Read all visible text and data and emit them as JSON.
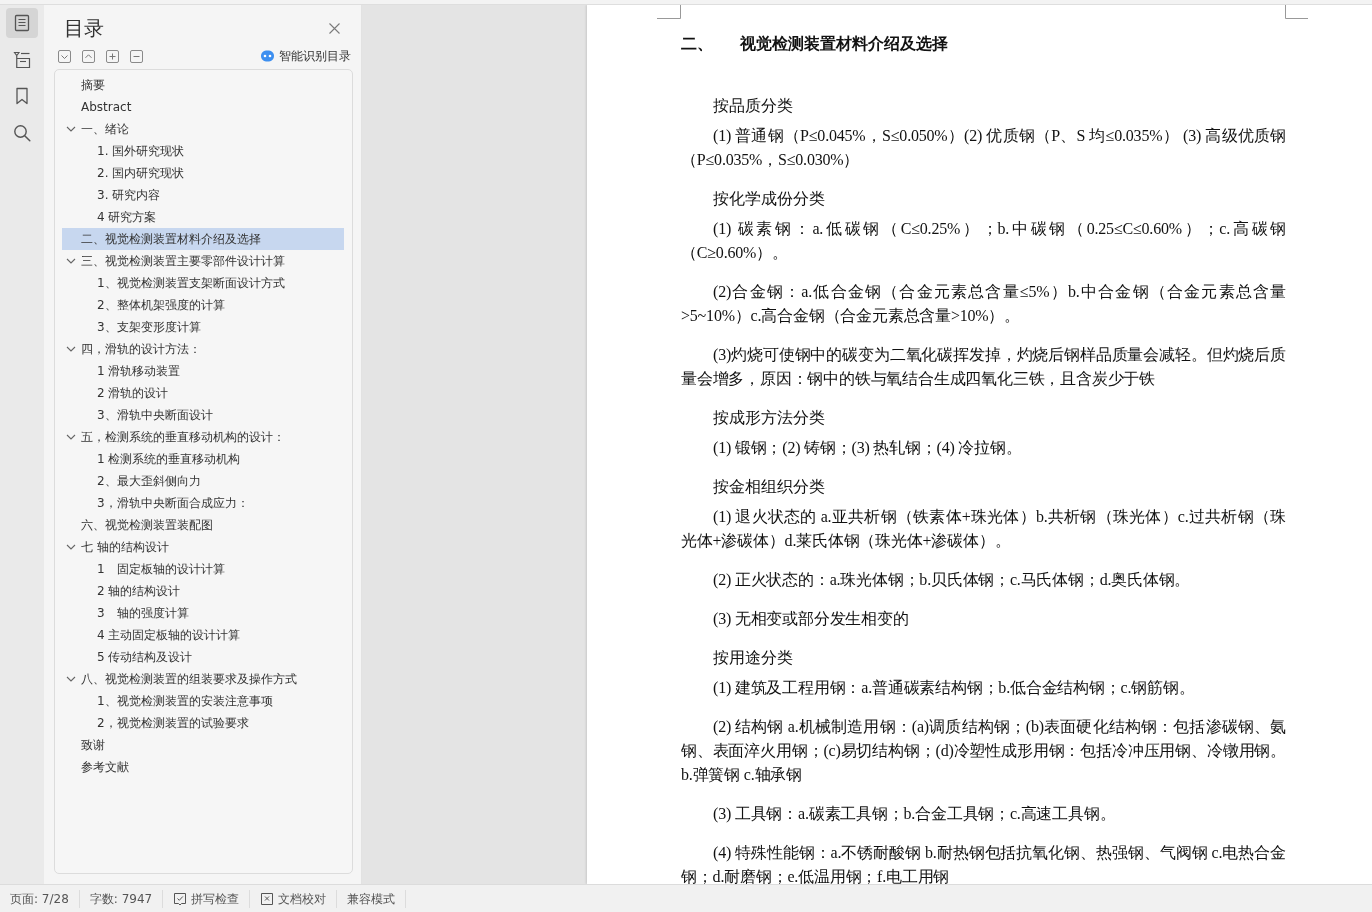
{
  "rail": [
    {
      "kind": "contents",
      "selected": true
    },
    {
      "kind": "outline",
      "selected": false
    },
    {
      "kind": "bookmark",
      "selected": false
    },
    {
      "kind": "search",
      "selected": false
    }
  ],
  "toc": {
    "title": "目录",
    "smart_button": "智能识别目录",
    "items": [
      {
        "label": "摘要",
        "selected": false
      },
      {
        "label": "Abstract",
        "selected": false
      },
      {
        "label": "一、绪论",
        "selected": false,
        "expanded": true,
        "children": [
          {
            "label": "1. 国外研究现状",
            "selected": false
          },
          {
            "label": "2. 国内研究现状",
            "selected": false
          },
          {
            "label": "3. 研究内容",
            "selected": false
          },
          {
            "label": "4 研究方案",
            "selected": false
          }
        ]
      },
      {
        "label": "二、视觉检测装置材料介绍及选择",
        "selected": true
      },
      {
        "label": "三、视觉检测装置主要零部件设计计算",
        "selected": false,
        "expanded": true,
        "children": [
          {
            "label": "1、视觉检测装置支架断面设计方式",
            "selected": false
          },
          {
            "label": "2、整体机架强度的计算",
            "selected": false
          },
          {
            "label": "3、支架变形度计算",
            "selected": false
          }
        ]
      },
      {
        "label": "四，滑轨的设计方法：",
        "selected": false,
        "expanded": true,
        "children": [
          {
            "label": "1 滑轨移动装置",
            "selected": false
          },
          {
            "label": "2 滑轨的设计",
            "selected": false
          },
          {
            "label": "3、滑轨中央断面设计",
            "selected": false
          }
        ]
      },
      {
        "label": "五，检测系统的垂直移动机构的设计：",
        "selected": false,
        "expanded": true,
        "children": [
          {
            "label": "1 检测系统的垂直移动机构",
            "selected": false
          },
          {
            "label": "2、最大歪斜侧向力",
            "selected": false
          },
          {
            "label": "3，滑轨中央断面合成应力：",
            "selected": false
          }
        ]
      },
      {
        "label": "六、视觉检测装置装配图",
        "selected": false
      },
      {
        "label": "七 轴的结构设计",
        "selected": false,
        "expanded": true,
        "children": [
          {
            "label": "1　固定板轴的设计计算",
            "selected": false
          },
          {
            "label": "2 轴的结构设计",
            "selected": false
          },
          {
            "label": "3　轴的强度计算",
            "selected": false
          },
          {
            "label": "4 主动固定板轴的设计计算",
            "selected": false
          },
          {
            "label": "5 传动结构及设计",
            "selected": false
          }
        ]
      },
      {
        "label": "八、视觉检测装置的组装要求及操作方式",
        "selected": false,
        "expanded": true,
        "children": [
          {
            "label": "1、视觉检测装置的安装注意事项",
            "selected": false
          },
          {
            "label": "2，视觉检测装置的试验要求",
            "selected": false
          }
        ]
      },
      {
        "label": "致谢",
        "selected": false
      },
      {
        "label": "参考文献",
        "selected": false
      }
    ]
  },
  "document": {
    "heading": {
      "number": "二、",
      "title": "视觉检测装置材料介绍及选择"
    },
    "blocks": [
      {
        "kind": "subheading",
        "text": "按品质分类"
      },
      {
        "kind": "paragraph",
        "text": "(1) 普通钢（P≤0.045%，S≤0.050%）(2) 优质钢（P、S 均≤0.035%） (3) 高级优质钢（P≤0.035%，S≤0.030%）"
      },
      {
        "kind": "subheading",
        "text": "按化学成份分类"
      },
      {
        "kind": "paragraph",
        "text": "(1) 碳素钢：a.低碳钢（C≤0.25%）；b.中碳钢（0.25≤C≤0.60%）；c.高碳钢（C≥0.60%）。"
      },
      {
        "kind": "paragraph",
        "text": "(2)合金钢：a.低合金钢（合金元素总含量≤5%）b.中合金钢（合金元素总含量>5~10%）c.高合金钢（合金元素总含量>10%）。"
      },
      {
        "kind": "paragraph",
        "text": "(3)灼烧可使钢中的碳变为二氧化碳挥发掉，灼烧后钢样品质量会减轻。但灼烧后质量会增多，原因：钢中的铁与氧结合生成四氧化三铁，且含炭少于铁"
      },
      {
        "kind": "subheading",
        "text": "按成形方法分类"
      },
      {
        "kind": "paragraph",
        "text": "(1) 锻钢；(2) 铸钢；(3) 热轧钢；(4) 冷拉钢。"
      },
      {
        "kind": "subheading",
        "text": "按金相组织分类"
      },
      {
        "kind": "paragraph",
        "text": "(1) 退火状态的 a.亚共析钢（铁素体+珠光体）b.共析钢（珠光体）c.过共析钢（珠光体+渗碳体）d.莱氏体钢（珠光体+渗碳体）。"
      },
      {
        "kind": "paragraph",
        "text": "(2) 正火状态的：a.珠光体钢；b.贝氏体钢；c.马氏体钢；d.奥氏体钢。"
      },
      {
        "kind": "paragraph",
        "text": "(3) 无相变或部分发生相变的"
      },
      {
        "kind": "subheading",
        "text": "按用途分类"
      },
      {
        "kind": "paragraph",
        "text": "(1) 建筑及工程用钢：a.普通碳素结构钢；b.低合金结构钢；c.钢筋钢。"
      },
      {
        "kind": "paragraph",
        "text": "(2) 结构钢 a.机械制造用钢：(a)调质结构钢；(b)表面硬化结构钢：包括渗碳钢、氨钢、表面淬火用钢；(c)易切结构钢；(d)冷塑性成形用钢：包括冷冲压用钢、冷镦用钢。b.弹簧钢 c.轴承钢"
      },
      {
        "kind": "paragraph",
        "text": "(3) 工具钢：a.碳素工具钢；b.合金工具钢；c.高速工具钢。"
      },
      {
        "kind": "paragraph",
        "text": "(4) 特殊性能钢：a.不锈耐酸钢 b.耐热钢包括抗氧化钢、热强钢、气阀钢 c.电热合金钢；d.耐磨钢；e.低温用钢；f.电工用钢"
      }
    ]
  },
  "status_bar": [
    {
      "kind": "text",
      "label": "页面: 7/28"
    },
    {
      "kind": "text",
      "label": "字数: 7947"
    },
    {
      "kind": "spell-check",
      "label": "拼写检查"
    },
    {
      "kind": "proofread",
      "label": "文档校对"
    },
    {
      "kind": "text",
      "label": "兼容模式"
    }
  ]
}
